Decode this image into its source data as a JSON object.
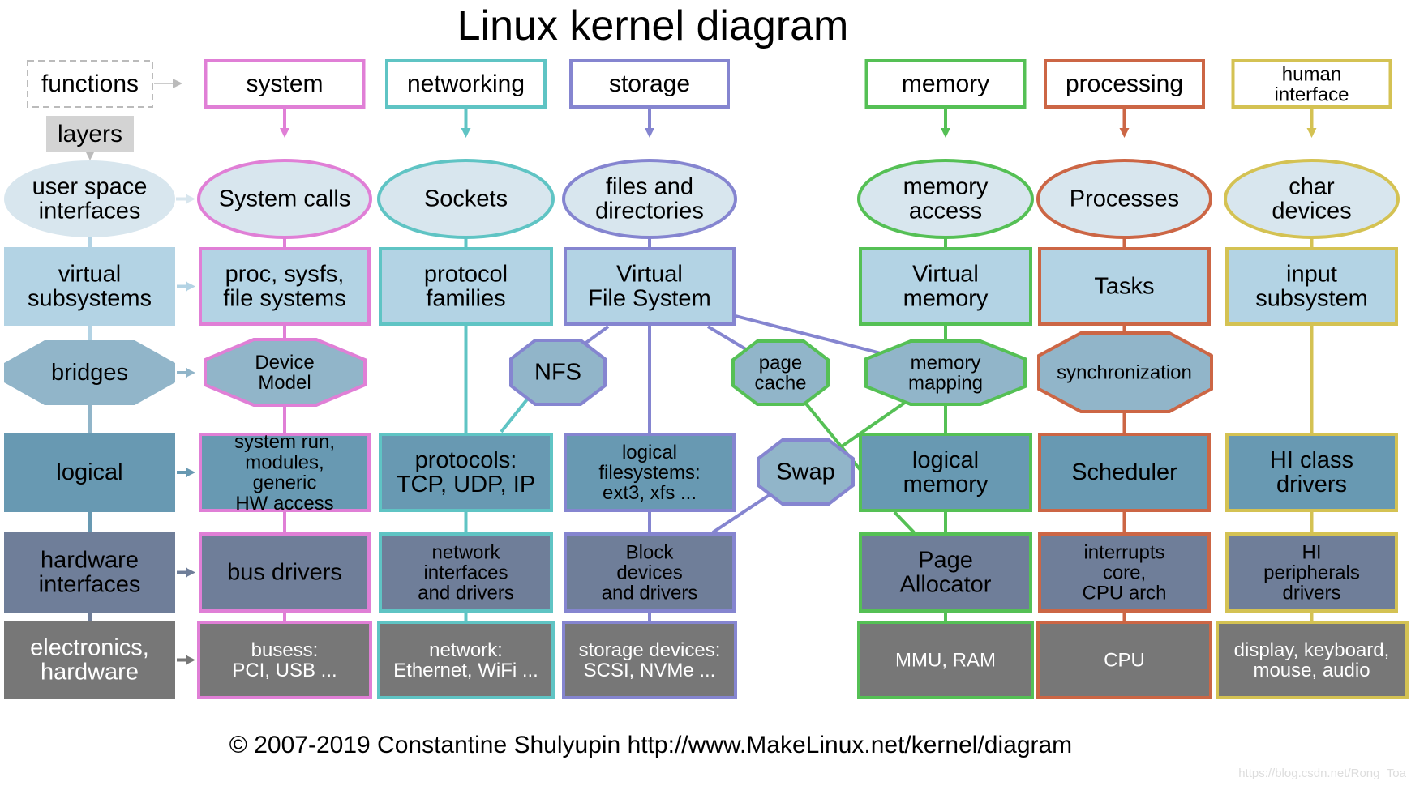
{
  "title": "Linux kernel diagram",
  "footer": "© 2007-2019 Constantine Shulyupin http://www.MakeLinux.net/kernel/diagram",
  "watermark": "https://blog.csdn.net/Rong_Toa",
  "colors": {
    "system": "#e07fd6",
    "networking": "#5fc4c4",
    "storage": "#8585d0",
    "memory": "#55c055",
    "processing": "#cc6645",
    "human_interface": "#d4c253",
    "layers_bg": "#d3d3d3",
    "user_space": "#d8e6ee",
    "virtual": "#b3d3e4",
    "bridges": "#91b5c9",
    "logical": "#6899b2",
    "hardware_interfaces": "#6f7e99",
    "electronics": "#777777"
  },
  "legend": {
    "functions": "functions",
    "layers": "layers"
  },
  "layers": [
    {
      "id": "user_space",
      "label": [
        "user space",
        "interfaces"
      ]
    },
    {
      "id": "virtual",
      "label": [
        "virtual",
        "subsystems"
      ]
    },
    {
      "id": "bridges",
      "label": [
        "bridges"
      ]
    },
    {
      "id": "logical",
      "label": [
        "logical"
      ]
    },
    {
      "id": "hardware_interfaces",
      "label": [
        "hardware",
        "interfaces"
      ]
    },
    {
      "id": "electronics",
      "label": [
        "electronics,",
        "hardware"
      ]
    }
  ],
  "functions": [
    {
      "id": "system",
      "header": [
        "system"
      ],
      "cells": {
        "user_space": [
          "System calls"
        ],
        "virtual": [
          "proc, sysfs,",
          "file systems"
        ],
        "bridges": [
          "Device",
          "Model"
        ],
        "logical": [
          "system run,",
          "modules,",
          "generic",
          "HW access"
        ],
        "hardware_interfaces": [
          "bus drivers"
        ],
        "electronics": [
          "busess:",
          "PCI, USB ..."
        ]
      }
    },
    {
      "id": "networking",
      "header": [
        "networking"
      ],
      "cells": {
        "user_space": [
          "Sockets"
        ],
        "virtual": [
          "protocol",
          "families"
        ],
        "logical": [
          "protocols:",
          "TCP, UDP, IP"
        ],
        "hardware_interfaces": [
          "network",
          "interfaces",
          "and drivers"
        ],
        "electronics": [
          "network:",
          "Ethernet, WiFi ..."
        ]
      }
    },
    {
      "id": "storage",
      "header": [
        "storage"
      ],
      "cells": {
        "user_space": [
          "files and",
          "directories"
        ],
        "virtual": [
          "Virtual",
          "File System"
        ],
        "logical": [
          "logical",
          "filesystems:",
          "ext3, xfs ..."
        ],
        "hardware_interfaces": [
          "Block",
          "devices",
          "and drivers"
        ],
        "electronics": [
          "storage devices:",
          "SCSI, NVMe ..."
        ]
      }
    },
    {
      "id": "memory",
      "header": [
        "memory"
      ],
      "cells": {
        "user_space": [
          "memory",
          "access"
        ],
        "virtual": [
          "Virtual",
          "memory"
        ],
        "bridges": [
          "memory",
          "mapping"
        ],
        "logical": [
          "logical",
          "memory"
        ],
        "hardware_interfaces": [
          "Page",
          "Allocator"
        ],
        "electronics": [
          "MMU, RAM"
        ]
      }
    },
    {
      "id": "processing",
      "header": [
        "processing"
      ],
      "cells": {
        "user_space": [
          "Processes"
        ],
        "virtual": [
          "Tasks"
        ],
        "bridges": [
          "synchronization"
        ],
        "logical": [
          "Scheduler"
        ],
        "hardware_interfaces": [
          "interrupts",
          "core,",
          "CPU arch"
        ],
        "electronics": [
          "CPU"
        ]
      }
    },
    {
      "id": "human_interface",
      "header": [
        "human",
        "interface"
      ],
      "cells": {
        "user_space": [
          "char",
          "devices"
        ],
        "virtual": [
          "input",
          "subsystem"
        ],
        "logical": [
          "HI class",
          "drivers"
        ],
        "hardware_interfaces": [
          "HI",
          "peripherals",
          "drivers"
        ],
        "electronics": [
          "display, keyboard,",
          "mouse, audio"
        ]
      }
    }
  ],
  "bridge_nodes": [
    {
      "id": "nfs",
      "label": [
        "NFS"
      ],
      "function": "storage"
    },
    {
      "id": "page_cache",
      "label": [
        "page",
        "cache"
      ],
      "function": "memory"
    },
    {
      "id": "swap",
      "label": [
        "Swap"
      ],
      "function": "storage"
    }
  ]
}
